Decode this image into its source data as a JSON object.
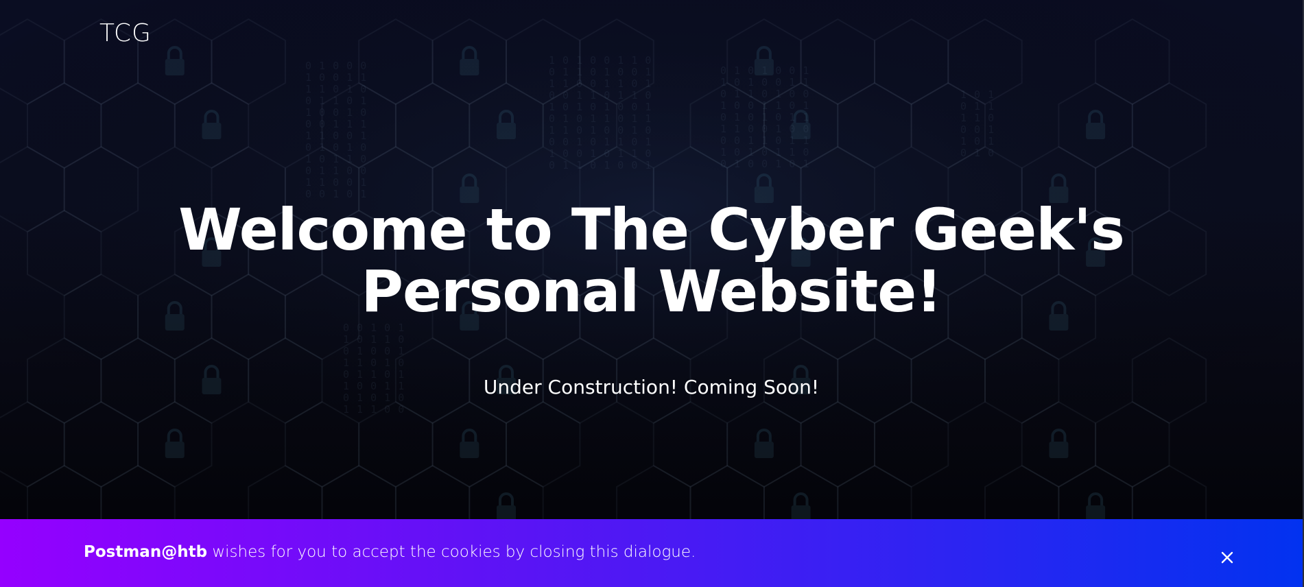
{
  "header": {
    "logo_text": "TCG"
  },
  "hero": {
    "title": "Welcome to The Cyber Geek's Personal Website!",
    "subtitle": "Under Construction! Coming Soon!"
  },
  "cookie_banner": {
    "sender": "Postman@htb",
    "message": " wishes for you to accept the cookies by closing this dialogue.",
    "close_icon": "close-icon"
  },
  "colors": {
    "background_top": "#0a0d22",
    "background_bottom": "#020205",
    "banner_gradient_start": "#9500ff",
    "banner_gradient_end": "#0232f0",
    "text": "#ffffff"
  }
}
